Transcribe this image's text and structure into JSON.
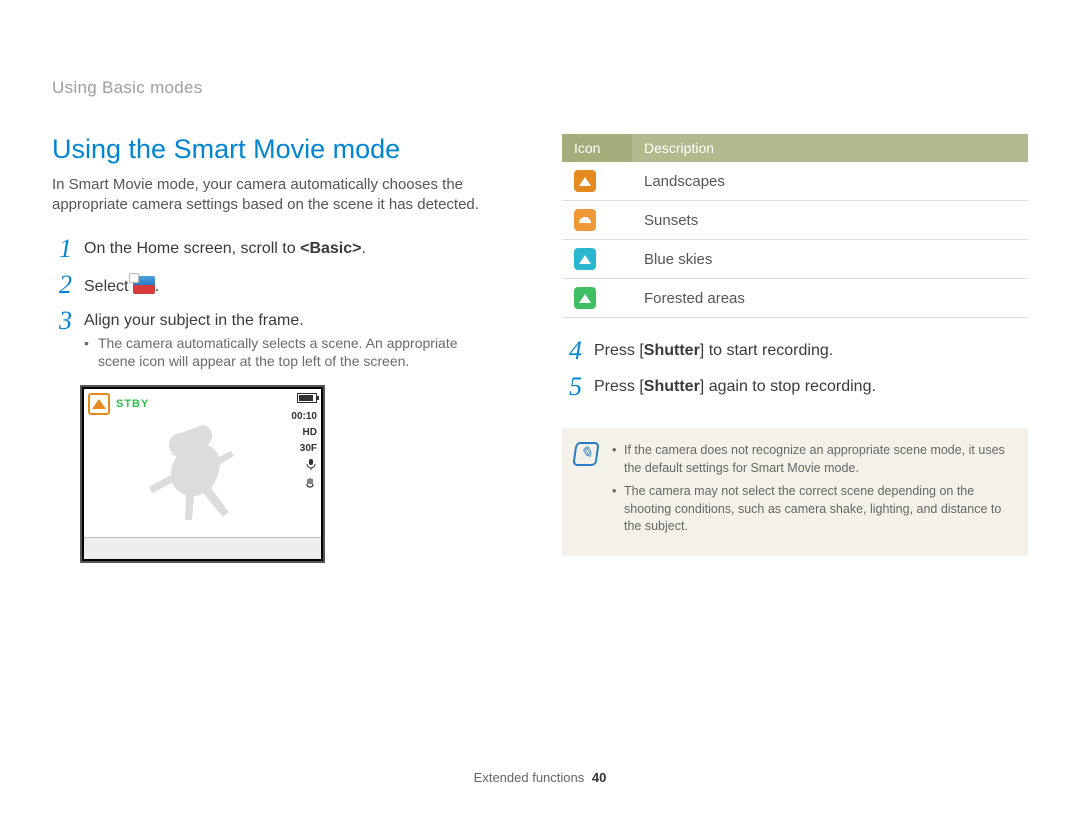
{
  "breadcrumb": "Using Basic modes",
  "heading": "Using the Smart Movie mode",
  "intro": "In Smart Movie mode, your camera automatically chooses the appropriate camera settings based on the scene it has detected.",
  "steps": {
    "s1": {
      "num": "1",
      "text_a": "On the Home screen, scroll to ",
      "bold": "<Basic>",
      "text_b": "."
    },
    "s2": {
      "num": "2",
      "text_a": "Select ",
      "text_b": "."
    },
    "s3": {
      "num": "3",
      "text": "Align your subject in the frame.",
      "sub": "The camera automatically selects a scene. An appropriate scene icon will appear at the top left of the screen."
    },
    "s4": {
      "num": "4",
      "text_a": "Press [",
      "bold": "Shutter",
      "text_b": "] to start recording."
    },
    "s5": {
      "num": "5",
      "text_a": "Press [",
      "bold": "Shutter",
      "text_b": "] again to stop recording."
    }
  },
  "screenshot": {
    "stby": "STBY",
    "time": "00:10",
    "hd": "HD",
    "rate": "30F",
    "mic": "🎤",
    "stab": "((🖐))"
  },
  "table": {
    "col_icon": "Icon",
    "col_desc": "Description",
    "rows": [
      {
        "label": "Landscapes"
      },
      {
        "label": "Sunsets"
      },
      {
        "label": "Blue skies"
      },
      {
        "label": "Forested areas"
      }
    ]
  },
  "note": {
    "items": [
      "If the camera does not recognize an appropriate scene mode, it uses the default settings for Smart Movie mode.",
      "The camera may not select the correct scene depending on the shooting conditions, such as camera shake, lighting, and distance to the subject."
    ]
  },
  "footer": {
    "section": "Extended functions",
    "page": "40"
  }
}
